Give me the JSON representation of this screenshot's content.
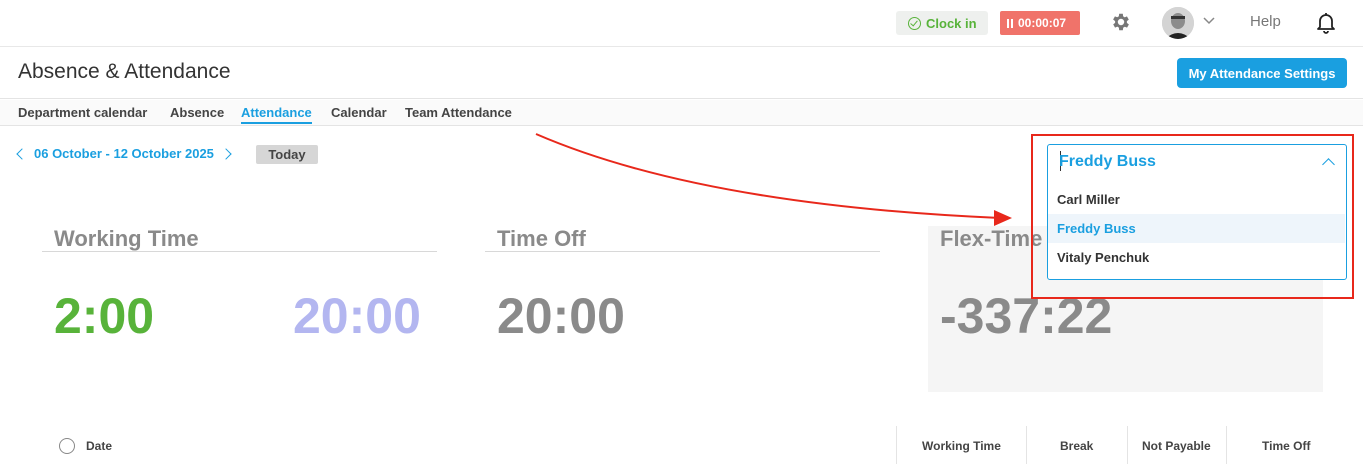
{
  "topbar": {
    "clock_in_label": "Clock in",
    "timer": "00:00:07",
    "help_label": "Help",
    "icons": [
      "check-circle-icon",
      "pause-icon",
      "gear-icon",
      "avatar",
      "chevron-down-icon",
      "bell-icon"
    ]
  },
  "header": {
    "title": "Absence & Attendance",
    "settings_button": "My Attendance Settings"
  },
  "tabs": [
    "Department calendar",
    "Absence",
    "Attendance",
    "Calendar",
    "Team Attendance"
  ],
  "active_tab": "Attendance",
  "date_nav": {
    "range": "06 October - 12 October 2025",
    "today_button": "Today"
  },
  "panels": {
    "working_time": {
      "title": "Working Time",
      "actual": "2:00",
      "target": "20:00"
    },
    "time_off": {
      "title": "Time Off",
      "value": "20:00"
    },
    "flex_time": {
      "title": "Flex-Time",
      "value": "-337:22"
    }
  },
  "employee_select": {
    "selected": "Freddy Buss",
    "options": [
      "Carl Miller",
      "Freddy Buss",
      "Vitaly Penchuk"
    ]
  },
  "table": {
    "columns": [
      "Date",
      "Working Time",
      "Break",
      "Not Payable",
      "Time Off"
    ]
  },
  "colors": {
    "accent": "#1a9fe0",
    "green": "#58b33a",
    "target_purple": "#b3b6f0",
    "timer_red": "#f0736a",
    "annotation_red": "#e8281b"
  }
}
